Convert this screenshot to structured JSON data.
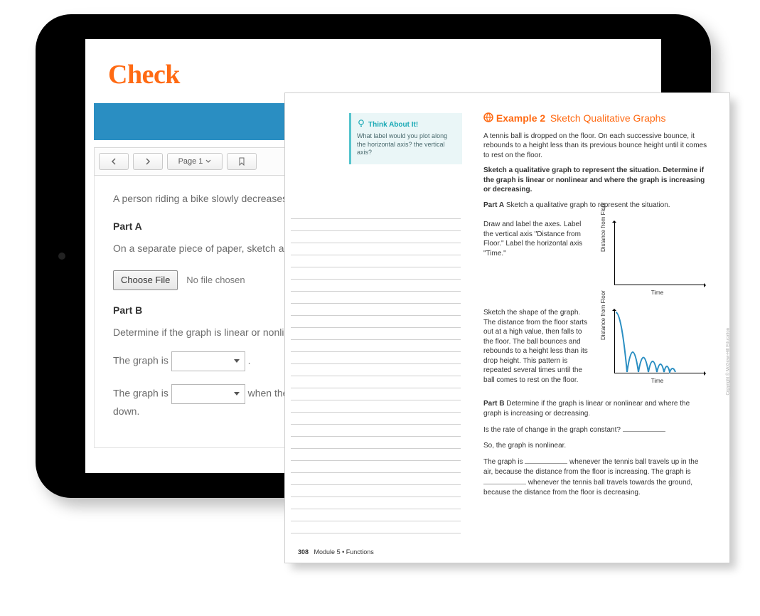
{
  "tablet": {
    "title": "Check",
    "toolbar": {
      "back_label": "←",
      "forward_label": "→",
      "page_label": "Page 1",
      "bookmark_label": "⚑"
    },
    "question": {
      "intro": "A person riding a bike slowly decreases their speed. Then they maintain that speed for a period of time.",
      "partA_label": "Part A",
      "partA_text": "On a separate piece of paper, sketch a qualitative graph to represent the situation.",
      "choose_file": "Choose File",
      "no_file": "No file chosen",
      "partB_label": "Part B",
      "partB_text": "Determine if the graph is linear or nonlinear and where the graph is increasing or decreasing.",
      "sentence1_prefix": "The graph is ",
      "sentence1_suffix": " .",
      "sentence2_prefix": "The graph is ",
      "sentence2_mid": " when the bike speeds up. The graph is decreasing when the bike slows down.",
      "down": "down."
    }
  },
  "page": {
    "think": {
      "header": "Think About It!",
      "body": "What label would you plot along the horizontal axis? the vertical axis?"
    },
    "footer": {
      "page_num": "308",
      "module": "Module 5 • Functions"
    },
    "example": {
      "icon": "globe",
      "title": "Example 2",
      "subtitle": "Sketch Qualitative Graphs",
      "intro": "A tennis ball is dropped on the floor. On each successive bounce, it rebounds to a height less than its previous bounce height until it comes to rest on the floor.",
      "task": "Sketch a qualitative graph to represent the situation. Determine if the graph is linear or nonlinear and where the graph is increasing or decreasing.",
      "partA_label": "Part A",
      "partA_text": "Sketch a qualitative graph to represent the situation.",
      "stepA1": "Draw and label the axes. Label the vertical axis \"Distance from Floor.\" Label the horizontal axis \"Time.\"",
      "stepA2": "Sketch the shape of the graph. The distance from the floor starts out at a high value, then falls to the floor. The ball bounces and rebounds to a height less than its drop height. This pattern is repeated several times until the ball comes to rest on the floor.",
      "chart": {
        "ylabel": "Distance from Floor",
        "xlabel": "Time"
      },
      "partB_label": "Part B",
      "partB_text": "Determine if the graph is linear or nonlinear and where the graph is increasing or decreasing.",
      "q1": "Is the rate of change in the graph constant? ",
      "so": "So, the graph is nonlinear.",
      "conclusion1a": "The graph is ",
      "conclusion1b": " whenever the tennis ball travels up in the air, because the distance from the floor is increasing. The graph is ",
      "conclusion1c": " whenever the tennis ball travels towards the ground, because the distance from the floor is decreasing."
    },
    "copyright": "Copyright © McGraw-Hill Education"
  }
}
